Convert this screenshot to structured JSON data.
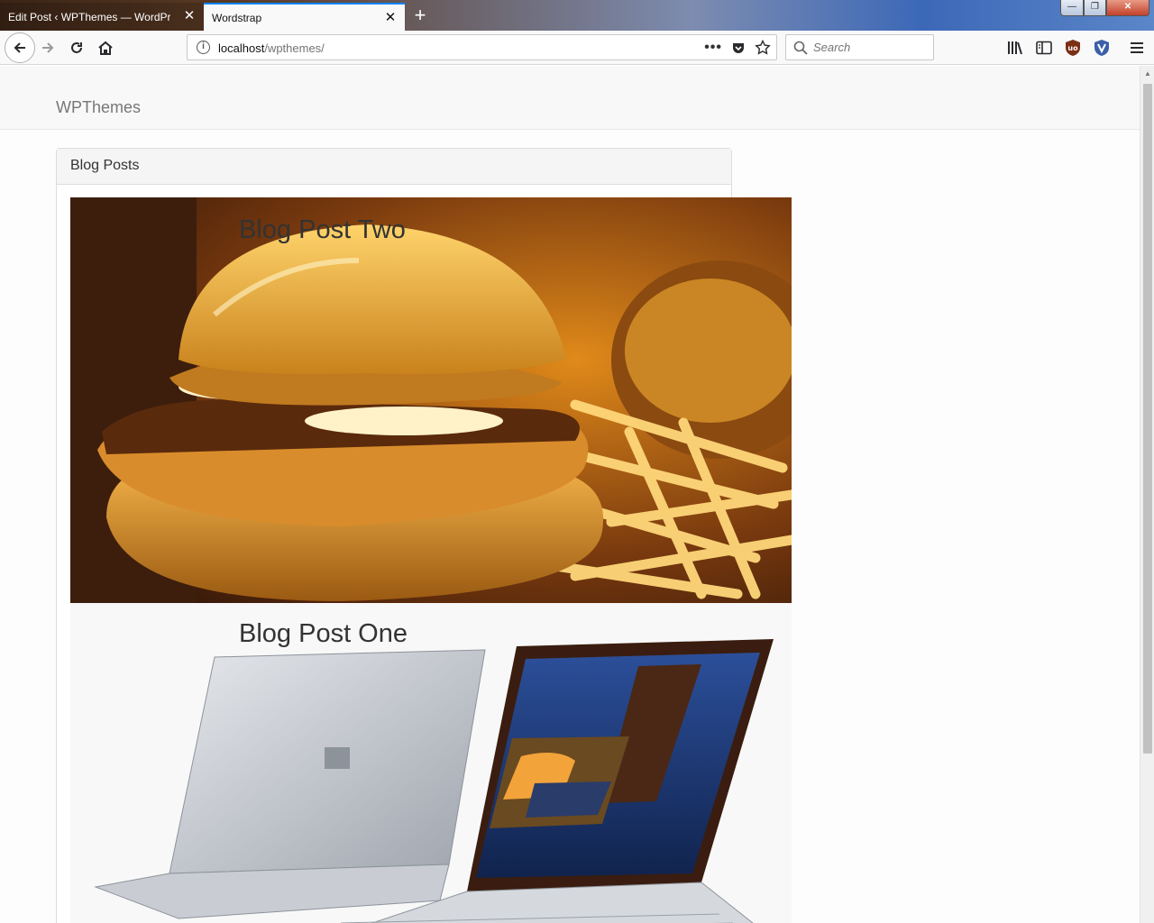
{
  "browser": {
    "tabs": [
      {
        "label": "Edit Post ‹ WPThemes — WordPress",
        "active": false
      },
      {
        "label": "Wordstrap",
        "active": true
      }
    ],
    "url": {
      "host": "localhost",
      "path": "/wpthemes/"
    },
    "search_placeholder": "Search",
    "accent": "#0a84ff"
  },
  "site": {
    "brand": "WPThemes",
    "panel_title": "Blog Posts",
    "posts": [
      {
        "title": "Blog Post Two",
        "image": "burger-and-fries"
      },
      {
        "title": "Blog Post One",
        "image": "surface-laptops"
      }
    ]
  }
}
